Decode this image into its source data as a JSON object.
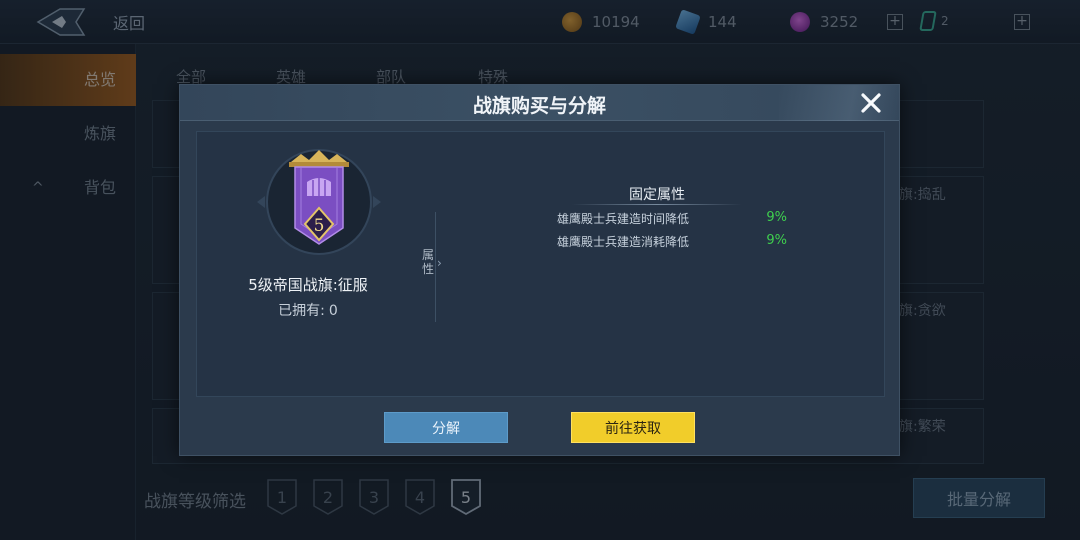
{
  "topbar": {
    "back_label": "返回",
    "resources": [
      {
        "icon": "gold-coin-icon",
        "value": "10194",
        "color": "#c98a2a"
      },
      {
        "icon": "blue-crystal-icon",
        "value": "144",
        "color": "#3f8fd1"
      },
      {
        "icon": "purple-gem-icon",
        "value": "3252",
        "color": "#b73fc7"
      }
    ],
    "ticket_count": "2"
  },
  "sidebar": {
    "items": [
      {
        "label": "总览",
        "active": true
      },
      {
        "label": "炼旗",
        "active": false
      },
      {
        "label": "背包",
        "active": false
      }
    ]
  },
  "tabs": [
    "全部",
    "英雄",
    "部队",
    "特殊"
  ],
  "bg_cards": {
    "right_titles": [
      "旗:捣乱",
      "旗:贪欲",
      "旗:繁荣"
    ]
  },
  "filter": {
    "label": "战旗等级筛选",
    "levels": [
      "1",
      "2",
      "3",
      "4",
      "5"
    ],
    "selected": "5"
  },
  "batch_button": "批量分解",
  "modal": {
    "title": "战旗购买与分解",
    "item": {
      "level": "5",
      "name": "5级帝国战旗:征服",
      "owned_label": "已拥有:",
      "owned_count": "0"
    },
    "attr_tab": "属性",
    "fixed_attr_title": "固定属性",
    "attributes": [
      {
        "name": "雄鹰殿士兵建造时间降低",
        "value": "9%"
      },
      {
        "name": "雄鹰殿士兵建造消耗降低",
        "value": "9%"
      }
    ],
    "buttons": {
      "decompose": "分解",
      "acquire": "前往获取"
    }
  }
}
